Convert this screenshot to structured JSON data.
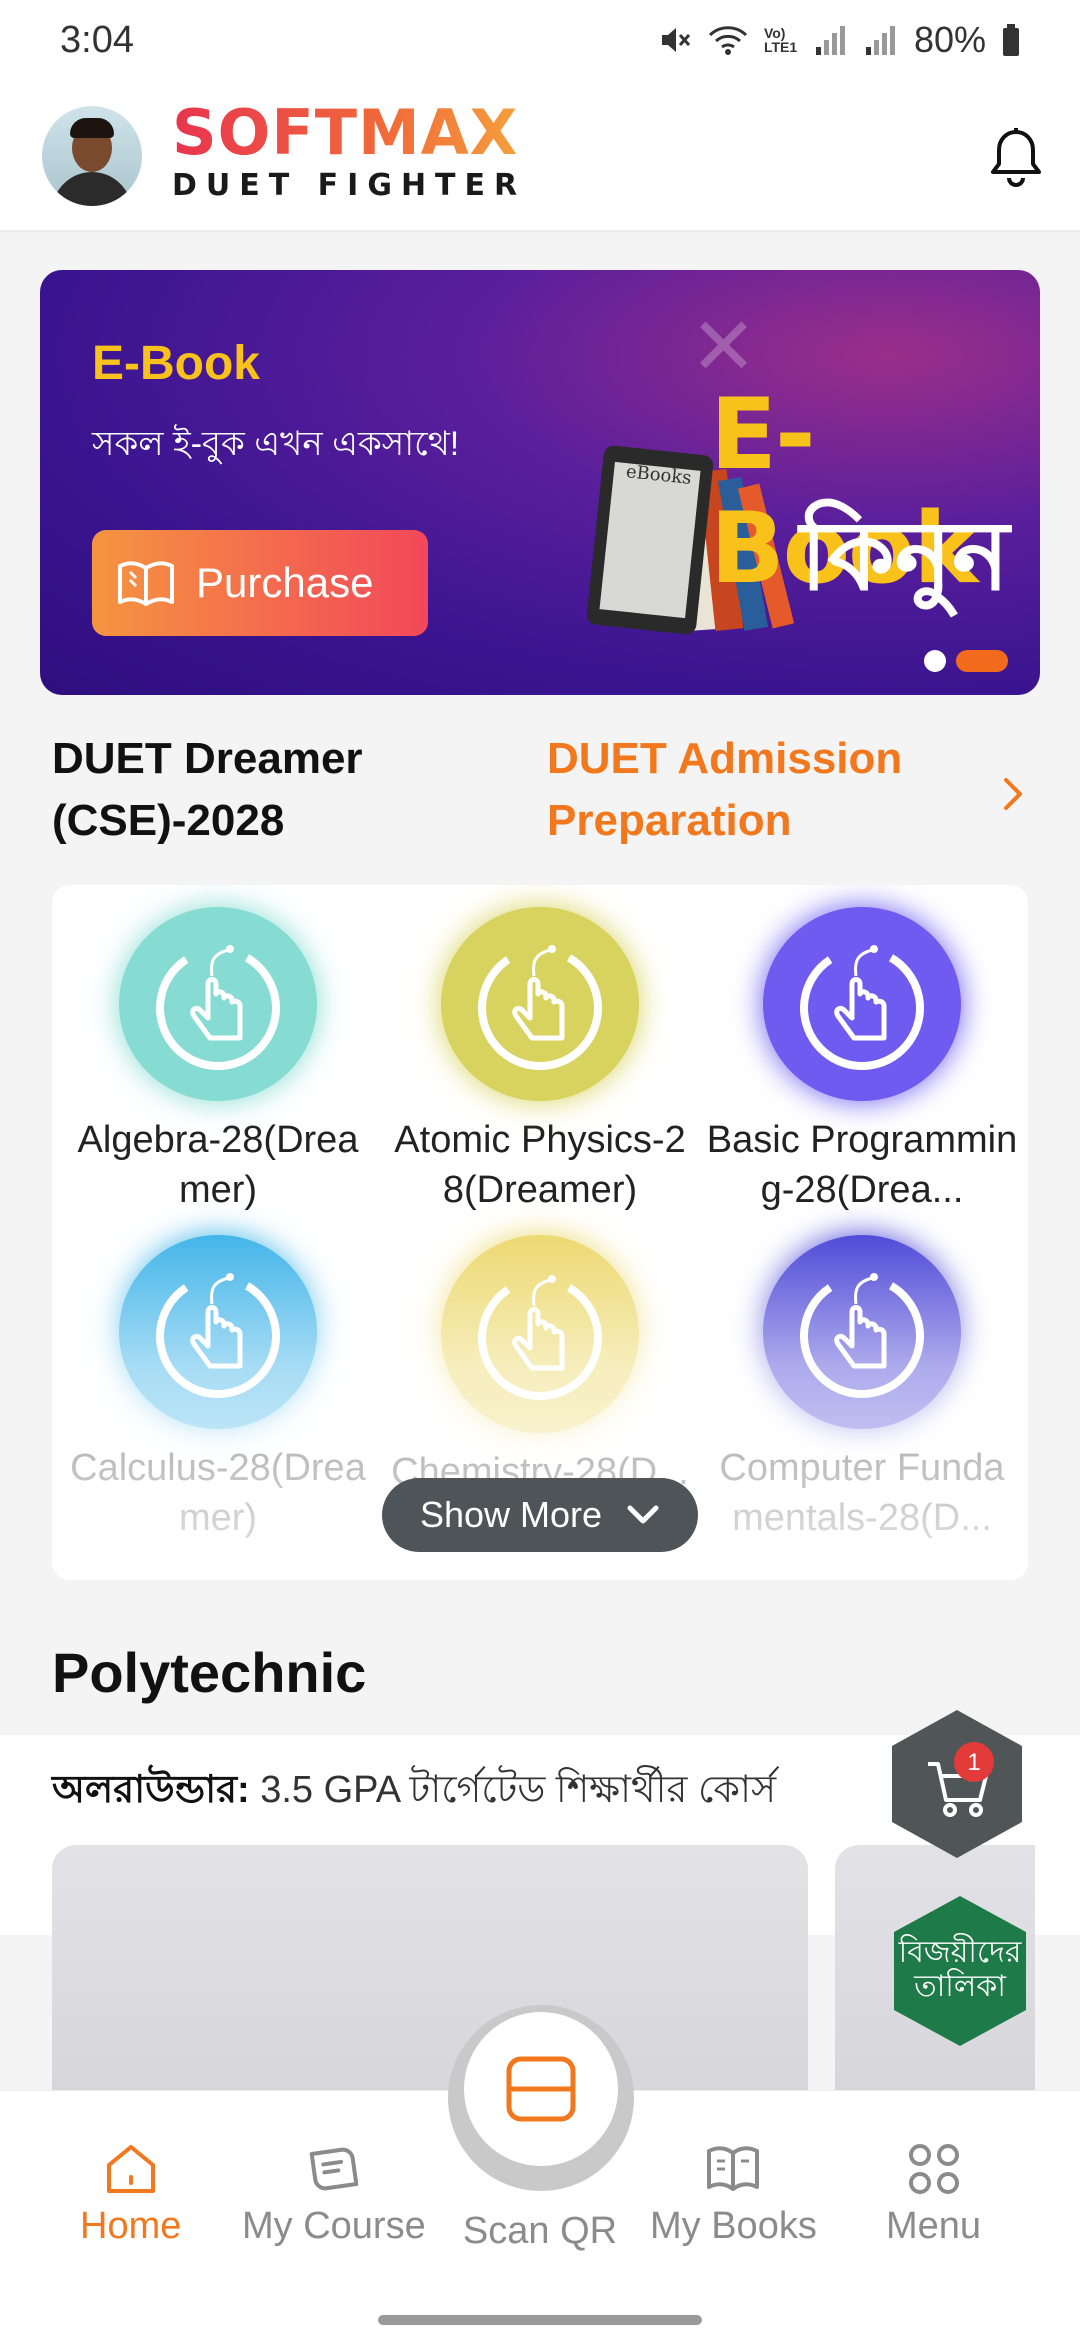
{
  "status_bar": {
    "time": "3:04",
    "lte_label": "Vo) LTE1",
    "battery": "80%"
  },
  "header": {
    "brand_name": "SOFTMAX",
    "brand_tagline": "DUET FIGHTER"
  },
  "banner": {
    "title": "E-Book",
    "subtitle": "সকল ই-বুক এখন একসাথে!",
    "purchase_label": "Purchase",
    "graphic_book_label": "eBooks",
    "graphic_title": "E-Book",
    "graphic_subtitle": "কিনুন",
    "slide_count": 2,
    "active_slide": 2
  },
  "course_section": {
    "batch_name": "DUET Dreamer (CSE)-2028",
    "program_name": "DUET Admission Preparation",
    "courses": [
      {
        "title": "Algebra-28(Dreamer)",
        "color": "#86dcd2"
      },
      {
        "title": "Atomic Physics-28(Dreamer)",
        "color": "#d8d35e"
      },
      {
        "title": "Basic Programming-28(Drea...",
        "color": "#6f5bf0"
      },
      {
        "title": "Calculus-28(Dreamer)",
        "color": "#3cb2e8"
      },
      {
        "title": "Chemistry-28(D...",
        "color": "#ecd86c"
      },
      {
        "title": "Computer Fundamentals-28(D...",
        "color": "#4a45d6"
      }
    ],
    "show_more_label": "Show More"
  },
  "polytechnic": {
    "title": "Polytechnic",
    "subtitle_bold": "অলরাউন্ডার:",
    "subtitle_text": " 3.5 GPA টার্গেটেড শিক্ষার্থীর কোর্স"
  },
  "floating": {
    "cart_count": "1",
    "winners_label": "বিজয়ীদের তালিকা"
  },
  "bottom_nav": {
    "home": "Home",
    "my_course": "My Course",
    "scan_qr": "Scan QR",
    "my_books": "My Books",
    "menu": "Menu"
  },
  "colors": {
    "accent": "#f2781e",
    "brand_gradient_start": "#e8344f",
    "brand_gradient_end": "#f5a23c",
    "banner_bg": "#3a1490"
  }
}
